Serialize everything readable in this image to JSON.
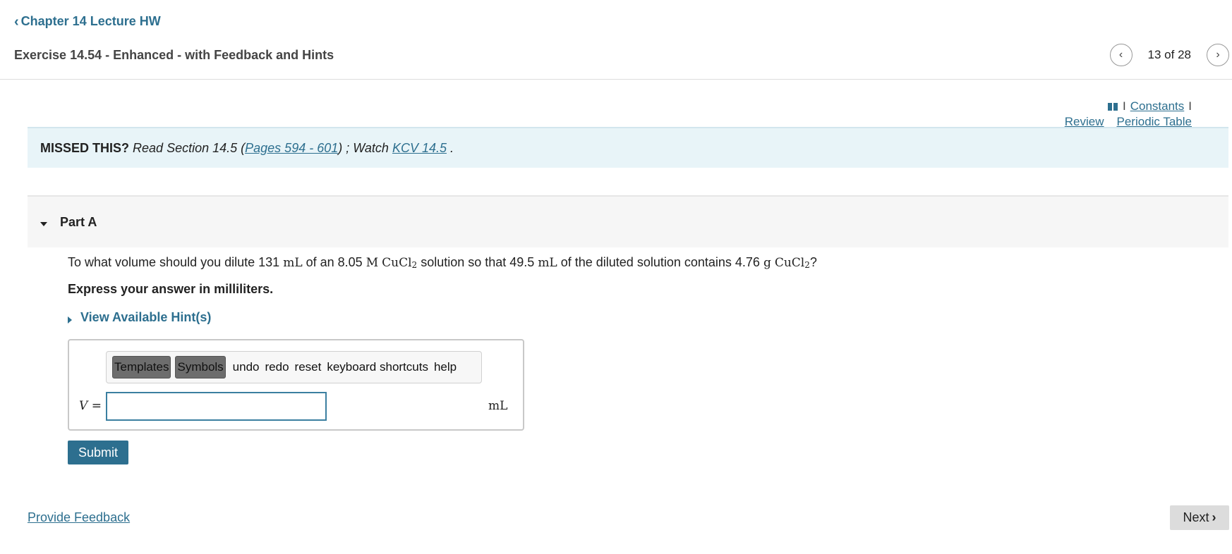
{
  "header": {
    "back_label": "Chapter 14 Lecture HW",
    "exercise_title": "Exercise 14.54 - Enhanced - with Feedback and Hints",
    "pager": {
      "position": "13 of 28"
    }
  },
  "tools": {
    "separator": "I",
    "constants": "Constants",
    "review": "Review",
    "periodic_table": "Periodic Table"
  },
  "missed": {
    "bold": "MISSED THIS?",
    "read_text": "Read Section 14.5 (",
    "pages_link": "Pages 594 - 601",
    "watch_text": ") ; Watch ",
    "kcv_link": "KCV 14.5",
    "end": " ."
  },
  "part": {
    "label": "Part A",
    "question": {
      "t1": "To what volume should you dilute 131 ",
      "u1": "mL",
      "t2": " of an 8.05 ",
      "u2": "M",
      "chem1": "CuCl",
      "sub1": "2",
      "t3": " solution so that 49.5 ",
      "u3": "mL",
      "t4": " of the diluted solution contains 4.76 ",
      "u4": "g",
      "chem2": "CuCl",
      "sub2": "2",
      "t5": "?"
    },
    "instruction": "Express your answer in milliliters.",
    "hints_label": "View Available Hint(s)"
  },
  "answer": {
    "toolbar": {
      "templates": "Templates",
      "symbols": "Symbols",
      "undo": "undo",
      "redo": "redo",
      "reset": "reset",
      "shortcuts": "keyboard shortcuts",
      "help": "help"
    },
    "variable": "V",
    "equals": "=",
    "input_value": "",
    "unit": "mL"
  },
  "actions": {
    "submit": "Submit",
    "feedback": "Provide Feedback",
    "next": "Next"
  },
  "colors": {
    "accent": "#2d6f8f",
    "missed_bg": "#e8f4f8",
    "part_bg": "#f6f6f6",
    "next_bg": "#dcdcdc"
  }
}
